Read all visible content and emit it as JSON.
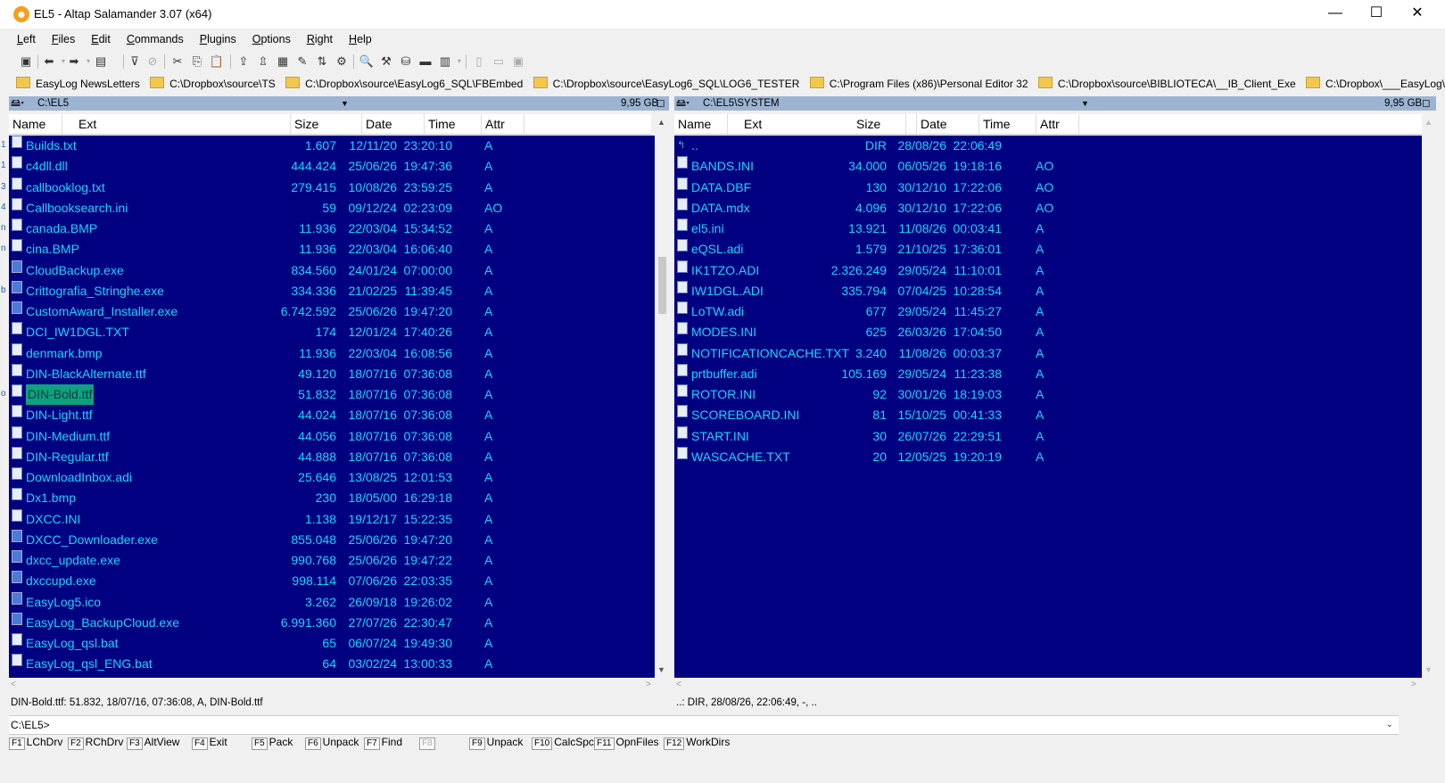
{
  "window": {
    "title": "EL5 - Altap Salamander 3.07 (x64)",
    "minimize": "—",
    "maximize": "☐",
    "close": "✕"
  },
  "menu": [
    "Left",
    "Files",
    "Edit",
    "Commands",
    "Plugins",
    "Options",
    "Right",
    "Help"
  ],
  "hotpaths": [
    "EasyLog NewsLetters",
    "C:\\Dropbox\\source\\TS",
    "C:\\Dropbox\\source\\EasyLog6_SQL\\FBEmbed",
    "C:\\Dropbox\\source\\EasyLog6_SQL\\LOG6_TESTER",
    "C:\\Program Files (x86)\\Personal Editor 32",
    "C:\\Dropbox\\source\\BIBLIOTECA\\__IB_Client_Exe",
    "C:\\Dropbox\\___EasyLog\\___EasyLog Marke"
  ],
  "left_panel": {
    "path": "C:\\EL5",
    "free": "9,95 GB",
    "columns": {
      "name": "Name",
      "ext": "Ext",
      "size": "Size",
      "date": "Date",
      "time": "Time",
      "attr": "Attr"
    },
    "files": [
      {
        "name": "Builds.txt",
        "size": "1.607",
        "date": "12/11/20",
        "time": "23:20:10",
        "attr": "A",
        "icon": "doc"
      },
      {
        "name": "c4dll.dll",
        "size": "444.424",
        "date": "25/06/26",
        "time": "19:47:36",
        "attr": "A",
        "icon": "doc"
      },
      {
        "name": "callbooklog.txt",
        "size": "279.415",
        "date": "10/08/26",
        "time": "23:59:25",
        "attr": "A",
        "icon": "doc"
      },
      {
        "name": "Callbooksearch.ini",
        "size": "59",
        "date": "09/12/24",
        "time": "02:23:09",
        "attr": "AO",
        "icon": "doc"
      },
      {
        "name": "canada.BMP",
        "size": "11.936",
        "date": "22/03/04",
        "time": "15:34:52",
        "attr": "A",
        "icon": "doc"
      },
      {
        "name": "cina.BMP",
        "size": "11.936",
        "date": "22/03/04",
        "time": "16:06:40",
        "attr": "A",
        "icon": "doc"
      },
      {
        "name": "CloudBackup.exe",
        "size": "834.560",
        "date": "24/01/24",
        "time": "07:00:00",
        "attr": "A",
        "icon": "exe"
      },
      {
        "name": "Crittografia_Stringhe.exe",
        "size": "334.336",
        "date": "21/02/25",
        "time": "11:39:45",
        "attr": "A",
        "icon": "exe"
      },
      {
        "name": "CustomAward_Installer.exe",
        "size": "6.742.592",
        "date": "25/06/26",
        "time": "19:47:20",
        "attr": "A",
        "icon": "exe"
      },
      {
        "name": "DCI_IW1DGL.TXT",
        "size": "174",
        "date": "12/01/24",
        "time": "17:40:26",
        "attr": "A",
        "icon": "doc"
      },
      {
        "name": "denmark.bmp",
        "size": "11.936",
        "date": "22/03/04",
        "time": "16:08:56",
        "attr": "A",
        "icon": "doc"
      },
      {
        "name": "DIN-BlackAlternate.ttf",
        "size": "49.120",
        "date": "18/07/16",
        "time": "07:36:08",
        "attr": "A",
        "icon": "doc"
      },
      {
        "name": "DIN-Bold.ttf",
        "size": "51.832",
        "date": "18/07/16",
        "time": "07:36:08",
        "attr": "A",
        "icon": "doc",
        "selected": true
      },
      {
        "name": "DIN-Light.ttf",
        "size": "44.024",
        "date": "18/07/16",
        "time": "07:36:08",
        "attr": "A",
        "icon": "doc"
      },
      {
        "name": "DIN-Medium.ttf",
        "size": "44.056",
        "date": "18/07/16",
        "time": "07:36:08",
        "attr": "A",
        "icon": "doc"
      },
      {
        "name": "DIN-Regular.ttf",
        "size": "44.888",
        "date": "18/07/16",
        "time": "07:36:08",
        "attr": "A",
        "icon": "doc"
      },
      {
        "name": "DownloadInbox.adi",
        "size": "25.646",
        "date": "13/08/25",
        "time": "12:01:53",
        "attr": "A",
        "icon": "doc"
      },
      {
        "name": "Dx1.bmp",
        "size": "230",
        "date": "18/05/00",
        "time": "16:29:18",
        "attr": "A",
        "icon": "doc"
      },
      {
        "name": "DXCC.INI",
        "size": "1.138",
        "date": "19/12/17",
        "time": "15:22:35",
        "attr": "A",
        "icon": "doc"
      },
      {
        "name": "DXCC_Downloader.exe",
        "size": "855.048",
        "date": "25/06/26",
        "time": "19:47:20",
        "attr": "A",
        "icon": "exe"
      },
      {
        "name": "dxcc_update.exe",
        "size": "990.768",
        "date": "25/06/26",
        "time": "19:47:22",
        "attr": "A",
        "icon": "exe"
      },
      {
        "name": "dxccupd.exe",
        "size": "998.114",
        "date": "07/06/26",
        "time": "22:03:35",
        "attr": "A",
        "icon": "exe"
      },
      {
        "name": "EasyLog5.ico",
        "size": "3.262",
        "date": "26/09/18",
        "time": "19:26:02",
        "attr": "A",
        "icon": "exe"
      },
      {
        "name": "EasyLog_BackupCloud.exe",
        "size": "6.991.360",
        "date": "27/07/26",
        "time": "22:30:47",
        "attr": "A",
        "icon": "exe"
      },
      {
        "name": "EasyLog_qsl.bat",
        "size": "65",
        "date": "06/07/24",
        "time": "19:49:30",
        "attr": "A",
        "icon": "doc"
      },
      {
        "name": "EasyLog_qsl_ENG.bat",
        "size": "64",
        "date": "03/02/24",
        "time": "13:00:33",
        "attr": "A",
        "icon": "doc"
      }
    ],
    "info": "DIN-Bold.ttf: 51.832, 18/07/16, 07:36:08, A, DIN-Bold.ttf",
    "edge_chars": [
      "1",
      "1",
      "3",
      "4",
      "n",
      "n",
      "",
      "b",
      "",
      "",
      "",
      "",
      "o"
    ]
  },
  "right_panel": {
    "path": "C:\\EL5\\SYSTEM",
    "free": "9,95 GB",
    "columns": {
      "name": "Name",
      "ext": "Ext",
      "size": "Size",
      "date": "Date",
      "time": "Time",
      "attr": "Attr"
    },
    "files": [
      {
        "name": "..",
        "size": "DIR",
        "date": "28/08/26",
        "time": "22:06:49",
        "attr": "",
        "icon": "up"
      },
      {
        "name": "BANDS.INI",
        "size": "34.000",
        "date": "06/05/26",
        "time": "19:18:16",
        "attr": "AO",
        "icon": "doc"
      },
      {
        "name": "DATA.DBF",
        "size": "130",
        "date": "30/12/10",
        "time": "17:22:06",
        "attr": "AO",
        "icon": "doc"
      },
      {
        "name": "DATA.mdx",
        "size": "4.096",
        "date": "30/12/10",
        "time": "17:22:06",
        "attr": "AO",
        "icon": "doc"
      },
      {
        "name": "el5.ini",
        "size": "13.921",
        "date": "11/08/26",
        "time": "00:03:41",
        "attr": "A",
        "icon": "doc"
      },
      {
        "name": "eQSL.adi",
        "size": "1.579",
        "date": "21/10/25",
        "time": "17:36:01",
        "attr": "A",
        "icon": "doc"
      },
      {
        "name": "IK1TZO.ADI",
        "size": "2.326.249",
        "date": "29/05/24",
        "time": "11:10:01",
        "attr": "A",
        "icon": "doc"
      },
      {
        "name": "IW1DGL.ADI",
        "size": "335.794",
        "date": "07/04/25",
        "time": "10:28:54",
        "attr": "A",
        "icon": "doc"
      },
      {
        "name": "LoTW.adi",
        "size": "677",
        "date": "29/05/24",
        "time": "11:45:27",
        "attr": "A",
        "icon": "doc"
      },
      {
        "name": "MODES.INI",
        "size": "625",
        "date": "26/03/26",
        "time": "17:04:50",
        "attr": "A",
        "icon": "doc"
      },
      {
        "name": "NOTIFICATIONCACHE.TXT",
        "size": "3.240",
        "date": "11/08/26",
        "time": "00:03:37",
        "attr": "A",
        "icon": "doc"
      },
      {
        "name": "prtbuffer.adi",
        "size": "105.169",
        "date": "29/05/24",
        "time": "11:23:38",
        "attr": "A",
        "icon": "doc"
      },
      {
        "name": "ROTOR.INI",
        "size": "92",
        "date": "30/01/26",
        "time": "18:19:03",
        "attr": "A",
        "icon": "doc"
      },
      {
        "name": "SCOREBOARD.INI",
        "size": "81",
        "date": "15/10/25",
        "time": "00:41:33",
        "attr": "A",
        "icon": "doc"
      },
      {
        "name": "START.INI",
        "size": "30",
        "date": "26/07/26",
        "time": "22:29:51",
        "attr": "A",
        "icon": "doc"
      },
      {
        "name": "WASCACHE.TXT",
        "size": "20",
        "date": "12/05/25",
        "time": "19:20:19",
        "attr": "A",
        "icon": "doc"
      }
    ],
    "info": "..: DIR, 28/08/26, 22:06:49, -, .."
  },
  "command_line": "C:\\EL5>",
  "fkeys": [
    {
      "key": "F1",
      "label": "LChDrv"
    },
    {
      "key": "F2",
      "label": "RChDrv"
    },
    {
      "key": "F3",
      "label": "AltView"
    },
    {
      "key": "F4",
      "label": "Exit"
    },
    {
      "key": "F5",
      "label": "Pack"
    },
    {
      "key": "F6",
      "label": "Unpack"
    },
    {
      "key": "F7",
      "label": "Find"
    },
    {
      "key": "F8",
      "label": ""
    },
    {
      "key": "F9",
      "label": "Unpack"
    },
    {
      "key": "F10",
      "label": "CalcSpc"
    },
    {
      "key": "F11",
      "label": "OpnFiles"
    },
    {
      "key": "F12",
      "label": "WorkDirs"
    }
  ],
  "colors": {
    "panel_bg": "#000080",
    "file_text": "#0fd7ff",
    "selection": "#10a080",
    "path_bar": "#9cb4d2"
  }
}
